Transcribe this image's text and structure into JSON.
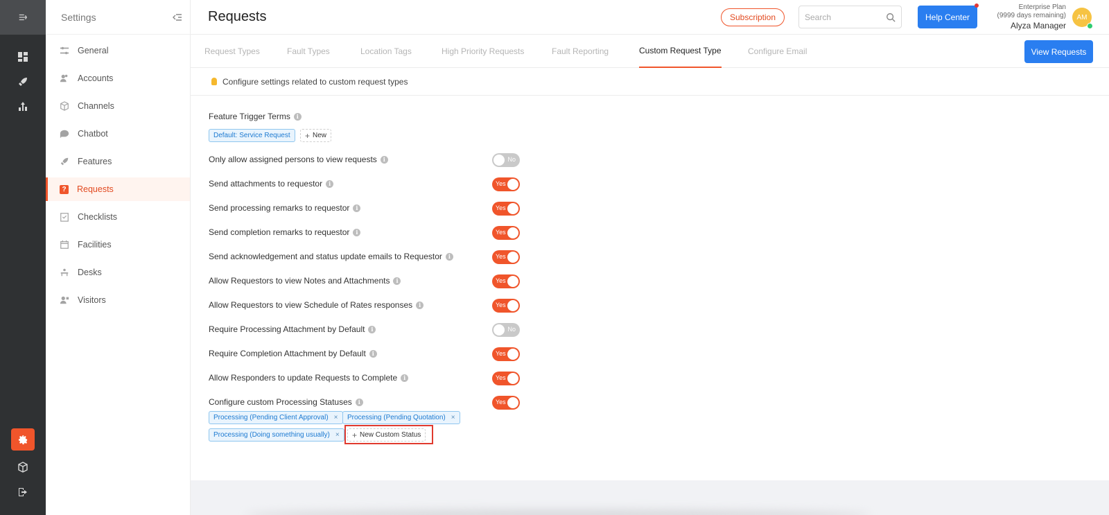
{
  "sidebar": {
    "title": "Settings",
    "items": [
      {
        "label": "General",
        "icon": "sliders-icon"
      },
      {
        "label": "Accounts",
        "icon": "users-icon"
      },
      {
        "label": "Channels",
        "icon": "cube-icon"
      },
      {
        "label": "Chatbot",
        "icon": "chat-icon"
      },
      {
        "label": "Features",
        "icon": "rocket-icon"
      },
      {
        "label": "Requests",
        "icon": "question-icon",
        "active": true
      },
      {
        "label": "Checklists",
        "icon": "checklist-icon"
      },
      {
        "label": "Facilities",
        "icon": "calendar-icon"
      },
      {
        "label": "Desks",
        "icon": "desk-icon"
      },
      {
        "label": "Visitors",
        "icon": "visitor-icon"
      }
    ]
  },
  "header": {
    "title": "Requests",
    "subscription_label": "Subscription",
    "search_placeholder": "Search",
    "help_label": "Help Center",
    "plan_name": "Enterprise Plan",
    "plan_remaining": "(9999 days remaining)",
    "user_name": "Alyza Manager",
    "avatar_initials": "AM"
  },
  "tabs": [
    {
      "label": "Request Types"
    },
    {
      "label": "Fault Types"
    },
    {
      "label": "Location Tags"
    },
    {
      "label": "High Priority Requests"
    },
    {
      "label": "Fault Reporting"
    },
    {
      "label": "Custom Request Type",
      "active": true
    },
    {
      "label": "Configure Email"
    }
  ],
  "view_requests_label": "View Requests",
  "info_text": "Configure settings related to custom request types",
  "trigger": {
    "label": "Feature Trigger Terms",
    "tag": "Default: Service Request",
    "new_label": "New"
  },
  "settings": [
    {
      "label": "Only allow assigned persons to view requests",
      "state": "No"
    },
    {
      "label": "Send attachments to requestor",
      "state": "Yes"
    },
    {
      "label": "Send processing remarks to requestor",
      "state": "Yes"
    },
    {
      "label": "Send completion remarks to requestor",
      "state": "Yes"
    },
    {
      "label": "Send acknowledgement and status update emails to Requestor",
      "state": "Yes"
    },
    {
      "label": "Allow Requestors to view Notes and Attachments",
      "state": "Yes"
    },
    {
      "label": "Allow Requestors to view Schedule of Rates responses",
      "state": "Yes"
    },
    {
      "label": "Require Processing Attachment by Default",
      "state": "No"
    },
    {
      "label": "Require Completion Attachment by Default",
      "state": "Yes"
    },
    {
      "label": "Allow Responders to update Requests to Complete",
      "state": "Yes"
    },
    {
      "label": "Configure custom Processing Statuses",
      "state": "Yes"
    }
  ],
  "custom_statuses": [
    "Processing (Pending Client Approval)",
    "Processing (Pending Quotation)",
    "Processing (Doing something usually)"
  ],
  "new_custom_status_label": "New Custom Status"
}
